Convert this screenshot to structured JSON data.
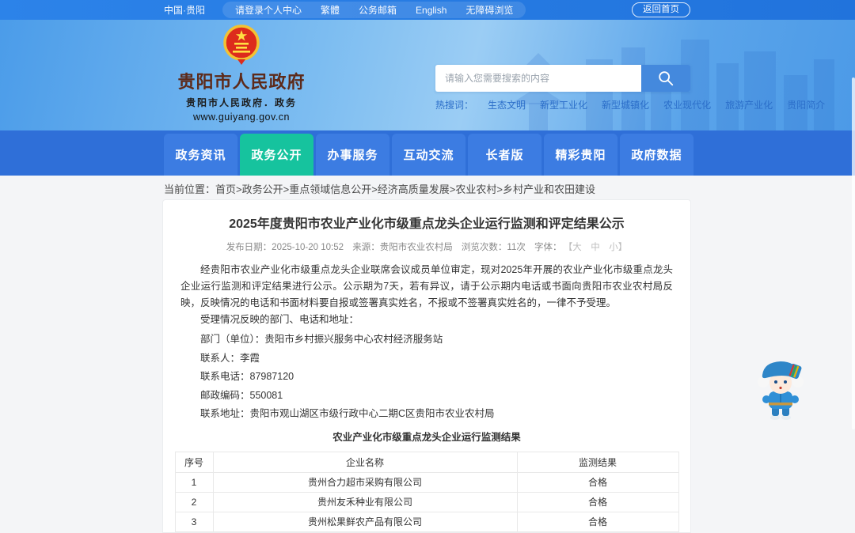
{
  "colors": {
    "topbar_blue": "#2c83e9",
    "nav_blue": "#2f6fd8",
    "active_tab_green": "#16c39e",
    "banner_blue": "#7dbdf1",
    "hot_word_blue": "#2b6ec9",
    "site_title_maroon": "#5d2a1a",
    "search_button_blue": "#4489dd"
  },
  "topbar": {
    "region": "中国·贵阳",
    "login": "请登录个人中心",
    "traditional": "繁體",
    "mail": "公务邮箱",
    "english": "English",
    "accessibility": "无障碍浏览",
    "return_home": "返回首页"
  },
  "header": {
    "site_title": "贵阳市人民政府",
    "site_subtitle": "贵阳市人民政府．政务",
    "site_url": "www.guiyang.gov.cn",
    "search_placeholder": "请输入您需要搜索的内容",
    "hot_label": "热搜词：",
    "hot_words": [
      "生态文明",
      "新型工业化",
      "新型城镇化",
      "农业现代化",
      "旅游产业化",
      "贵阳简介"
    ]
  },
  "nav": {
    "items": [
      {
        "label": "政务资讯",
        "active": false
      },
      {
        "label": "政务公开",
        "active": true
      },
      {
        "label": "办事服务",
        "active": false
      },
      {
        "label": "互动交流",
        "active": false
      },
      {
        "label": "长者版",
        "active": false
      },
      {
        "label": "精彩贵阳",
        "active": false
      },
      {
        "label": "政府数据",
        "active": false
      }
    ]
  },
  "breadcrumb": {
    "label": "当前位置：",
    "path": "首页>政务公开>重点领域信息公开>经济高质量发展>农业农村>乡村产业和农田建设"
  },
  "article": {
    "title": "2025年度贵阳市农业产业化市级重点龙头企业运行监测和评定结果公示",
    "meta": {
      "publish": "发布日期：2025-10-20 10:52",
      "source": "来源：贵阳市农业农村局",
      "views": "浏览次数：11次",
      "font_label": "字体：",
      "font_options": "【大　中　小】"
    },
    "paragraph1": "经贵阳市农业产业化市级重点龙头企业联席会议成员单位审定，现对2025年开展的农业产业化市级重点龙头企业运行监测和评定结果进行公示。公示期为7天，若有异议，请于公示期内电话或书面向贵阳市农业农村局反映，反映情况的电话和书面材料要自报或签署真实姓名，不报或不签署真实姓名的，一律不予受理。",
    "paragraph2": "受理情况反映的部门、电话和地址：",
    "contact_lines": [
      "部门（单位）：贵阳市乡村振兴服务中心农村经济服务站",
      "联系人：李霞",
      "联系电话：87987120",
      "邮政编码：550081",
      "联系地址：贵阳市观山湖区市级行政中心二期C区贵阳市农业农村局"
    ],
    "table": {
      "title": "农业产业化市级重点龙头企业运行监测结果",
      "headers": [
        "序号",
        "企业名称",
        "监测结果"
      ],
      "rows": [
        [
          "1",
          "贵州合力超市采购有限公司",
          "合格"
        ],
        [
          "2",
          "贵州友禾种业有限公司",
          "合格"
        ],
        [
          "3",
          "贵州松果鲜农产品有限公司",
          "合格"
        ]
      ]
    }
  }
}
